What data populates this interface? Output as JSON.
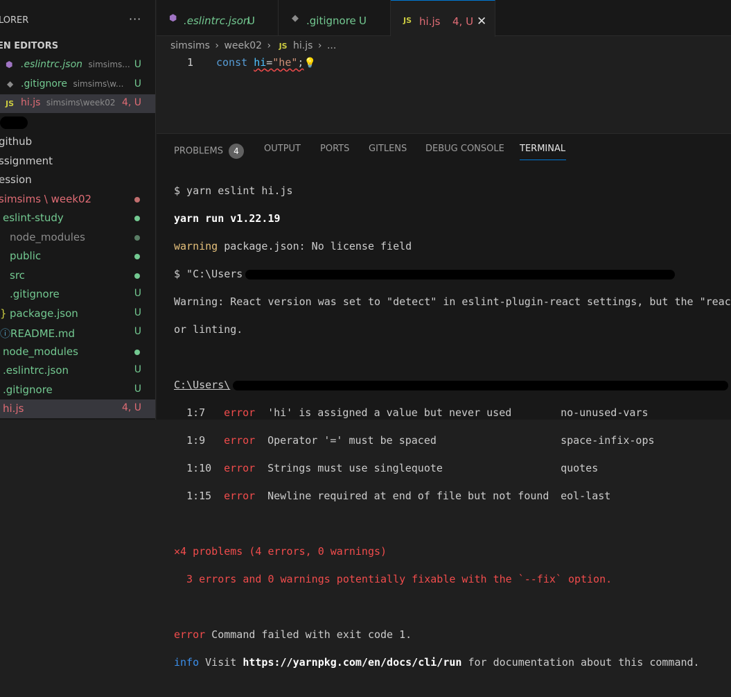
{
  "sidebar": {
    "title": "LORER",
    "more": "···",
    "section": "EN EDITORS",
    "open_editors": [
      {
        "icon": "eslint-icon",
        "name": ".eslintrc.json",
        "path": "simsims...",
        "badge": "U"
      },
      {
        "icon": "git-icon",
        "name": ".gitignore",
        "path": "simsims\\w...",
        "badge": "U"
      },
      {
        "icon": "js-icon",
        "icon_text": "JS",
        "name": "hi.js",
        "path": "simsims\\week02",
        "badge": "4, U"
      }
    ],
    "tree": [
      {
        "name": "github"
      },
      {
        "name": "ssignment"
      },
      {
        "name": "ession"
      },
      {
        "name": "simsims \\ week02",
        "dot": "#c16e6e"
      },
      {
        "name": "eslint-study",
        "dot": "#73c991"
      },
      {
        "name": "node_modules",
        "dot": "#73c991",
        "muted": true
      },
      {
        "name": "public",
        "dot": "#73c991"
      },
      {
        "name": "src",
        "dot": "#73c991"
      },
      {
        "name": ".gitignore",
        "badge": "U"
      },
      {
        "name": "package.json",
        "badge": "U"
      },
      {
        "name": "README.md",
        "badge": "U"
      },
      {
        "name": "node_modules",
        "dot": "#73c991"
      },
      {
        "name": ".eslintrc.json",
        "badge": "U"
      },
      {
        "name": ".gitignore",
        "badge": "U"
      },
      {
        "name": "hi.js",
        "badge": "4, U"
      }
    ]
  },
  "tabs": [
    {
      "icon": "eslint-icon",
      "label": ".eslintrc.json",
      "badge": "U"
    },
    {
      "icon": "git-icon",
      "label": ".gitignore",
      "badge": "U"
    },
    {
      "icon": "js-icon",
      "icon_text": "JS",
      "label": "hi.js",
      "badge": "4, U",
      "close": "✕"
    }
  ],
  "breadcrumb": {
    "parts": [
      "simsims",
      "week02"
    ],
    "file_icon": "JS",
    "file": "hi.js",
    "sep": "›",
    "ellipsis": "..."
  },
  "editor": {
    "line_number": "1",
    "code": {
      "kw": "const",
      "var": "hi",
      "op": "=",
      "str": "\"he\"",
      "semi": ";"
    }
  },
  "panel": {
    "tabs": [
      "PROBLEMS",
      "OUTPUT",
      "PORTS",
      "GITLENS",
      "DEBUG CONSOLE",
      "TERMINAL"
    ],
    "problems_count": "4",
    "active": "TERMINAL"
  },
  "terminal": {
    "cmd": "$ yarn eslint hi.js",
    "yarn_run": "yarn run v1.22.19",
    "warning_word": "warning",
    "warning_text": " package.json: No license field",
    "path_line": "$ \"C:\\Users",
    "react_warning_1": "Warning: React version was set to \"detect\" in eslint-plugin-react settings, but the \"react\"",
    "react_warning_2": "or linting.",
    "file_path": "C:\\Users\\",
    "errors": [
      {
        "loc": "1:7",
        "level": "error",
        "msg": "'hi' is assigned a value but never used",
        "rule": "no-unused-vars"
      },
      {
        "loc": "1:9",
        "level": "error",
        "msg": "Operator '=' must be spaced",
        "rule": "space-infix-ops"
      },
      {
        "loc": "1:10",
        "level": "error",
        "msg": "Strings must use singlequote",
        "rule": "quotes"
      },
      {
        "loc": "1:15",
        "level": "error",
        "msg": "Newline required at end of file but not found",
        "rule": "eol-last"
      }
    ],
    "summary_x": "✕",
    "summary": "4 problems (4 errors, 0 warnings)",
    "fixable": "  3 errors and 0 warnings potentially fixable with the `--fix` option.",
    "fail_word": "error",
    "fail_text": " Command failed with exit code 1.",
    "info_word": "info",
    "info_text_1": " Visit ",
    "info_url": "https://yarnpkg.com/en/docs/cli/run",
    "info_text_2": " for documentation about this command."
  },
  "colors": {
    "accent": "#0078d4",
    "error": "#f14c4c",
    "warning": "#e5c07b",
    "untracked": "#73c991",
    "modified_red": "#e06c75"
  }
}
